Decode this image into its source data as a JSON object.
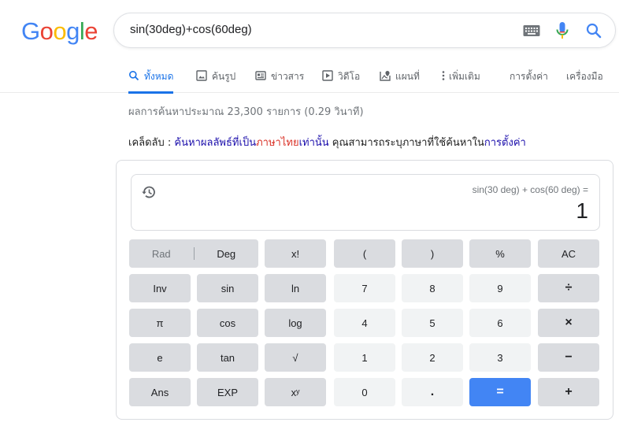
{
  "logo": {
    "letters": [
      "G",
      "o",
      "o",
      "g",
      "l",
      "e"
    ],
    "colors": [
      "#4285f4",
      "#ea4335",
      "#fbbc05",
      "#4285f4",
      "#34a853",
      "#ea4335"
    ]
  },
  "search": {
    "query": "sin(30deg)+cos(60deg)",
    "icons": [
      "keyboard-icon",
      "microphone-icon",
      "search-icon"
    ]
  },
  "tabs": [
    {
      "label": "ทั้งหมด",
      "icon": "search-icon",
      "active": true
    },
    {
      "label": "ค้นรูป",
      "icon": "image-icon"
    },
    {
      "label": "ข่าวสาร",
      "icon": "news-icon"
    },
    {
      "label": "วิดีโอ",
      "icon": "video-icon"
    },
    {
      "label": "แผนที่",
      "icon": "map-icon"
    },
    {
      "label": "เพิ่มเติม",
      "icon": "more-vert-icon"
    },
    {
      "label": "การตั้งค่า"
    },
    {
      "label": "เครื่องมือ"
    }
  ],
  "stats": "ผลการค้นหาประมาณ 23,300 รายการ (0.29 วินาที)",
  "tip": {
    "prefix": "เคล็ดลับ : ",
    "link1": "ค้นหาผลลัพธ์ที่เป็น",
    "red": "ภาษาไทย",
    "link2": "เท่านั้น",
    "middle": " คุณสามารถระบุภาษาที่ใช้ค้นหาใน",
    "link3": "การตั้งค่า"
  },
  "calculator": {
    "expression": "sin(30 deg) + cos(60 deg) =",
    "result": "1",
    "angle_mode": {
      "rad": "Rad",
      "deg": "Deg",
      "selected": "Deg"
    },
    "keys": {
      "factorial": "x!",
      "lparen": "(",
      "rparen": ")",
      "percent": "%",
      "ac": "AC",
      "inv": "Inv",
      "sin": "sin",
      "ln": "ln",
      "seven": "7",
      "eight": "8",
      "nine": "9",
      "divide": "÷",
      "pi": "π",
      "cos": "cos",
      "log": "log",
      "four": "4",
      "five": "5",
      "six": "6",
      "multiply": "×",
      "e": "e",
      "tan": "tan",
      "sqrt": "√",
      "one": "1",
      "two": "2",
      "three": "3",
      "minus": "−",
      "ans": "Ans",
      "exp": "EXP",
      "power": "xʸ",
      "zero": "0",
      "dot": ".",
      "equals": "=",
      "plus": "+"
    }
  }
}
